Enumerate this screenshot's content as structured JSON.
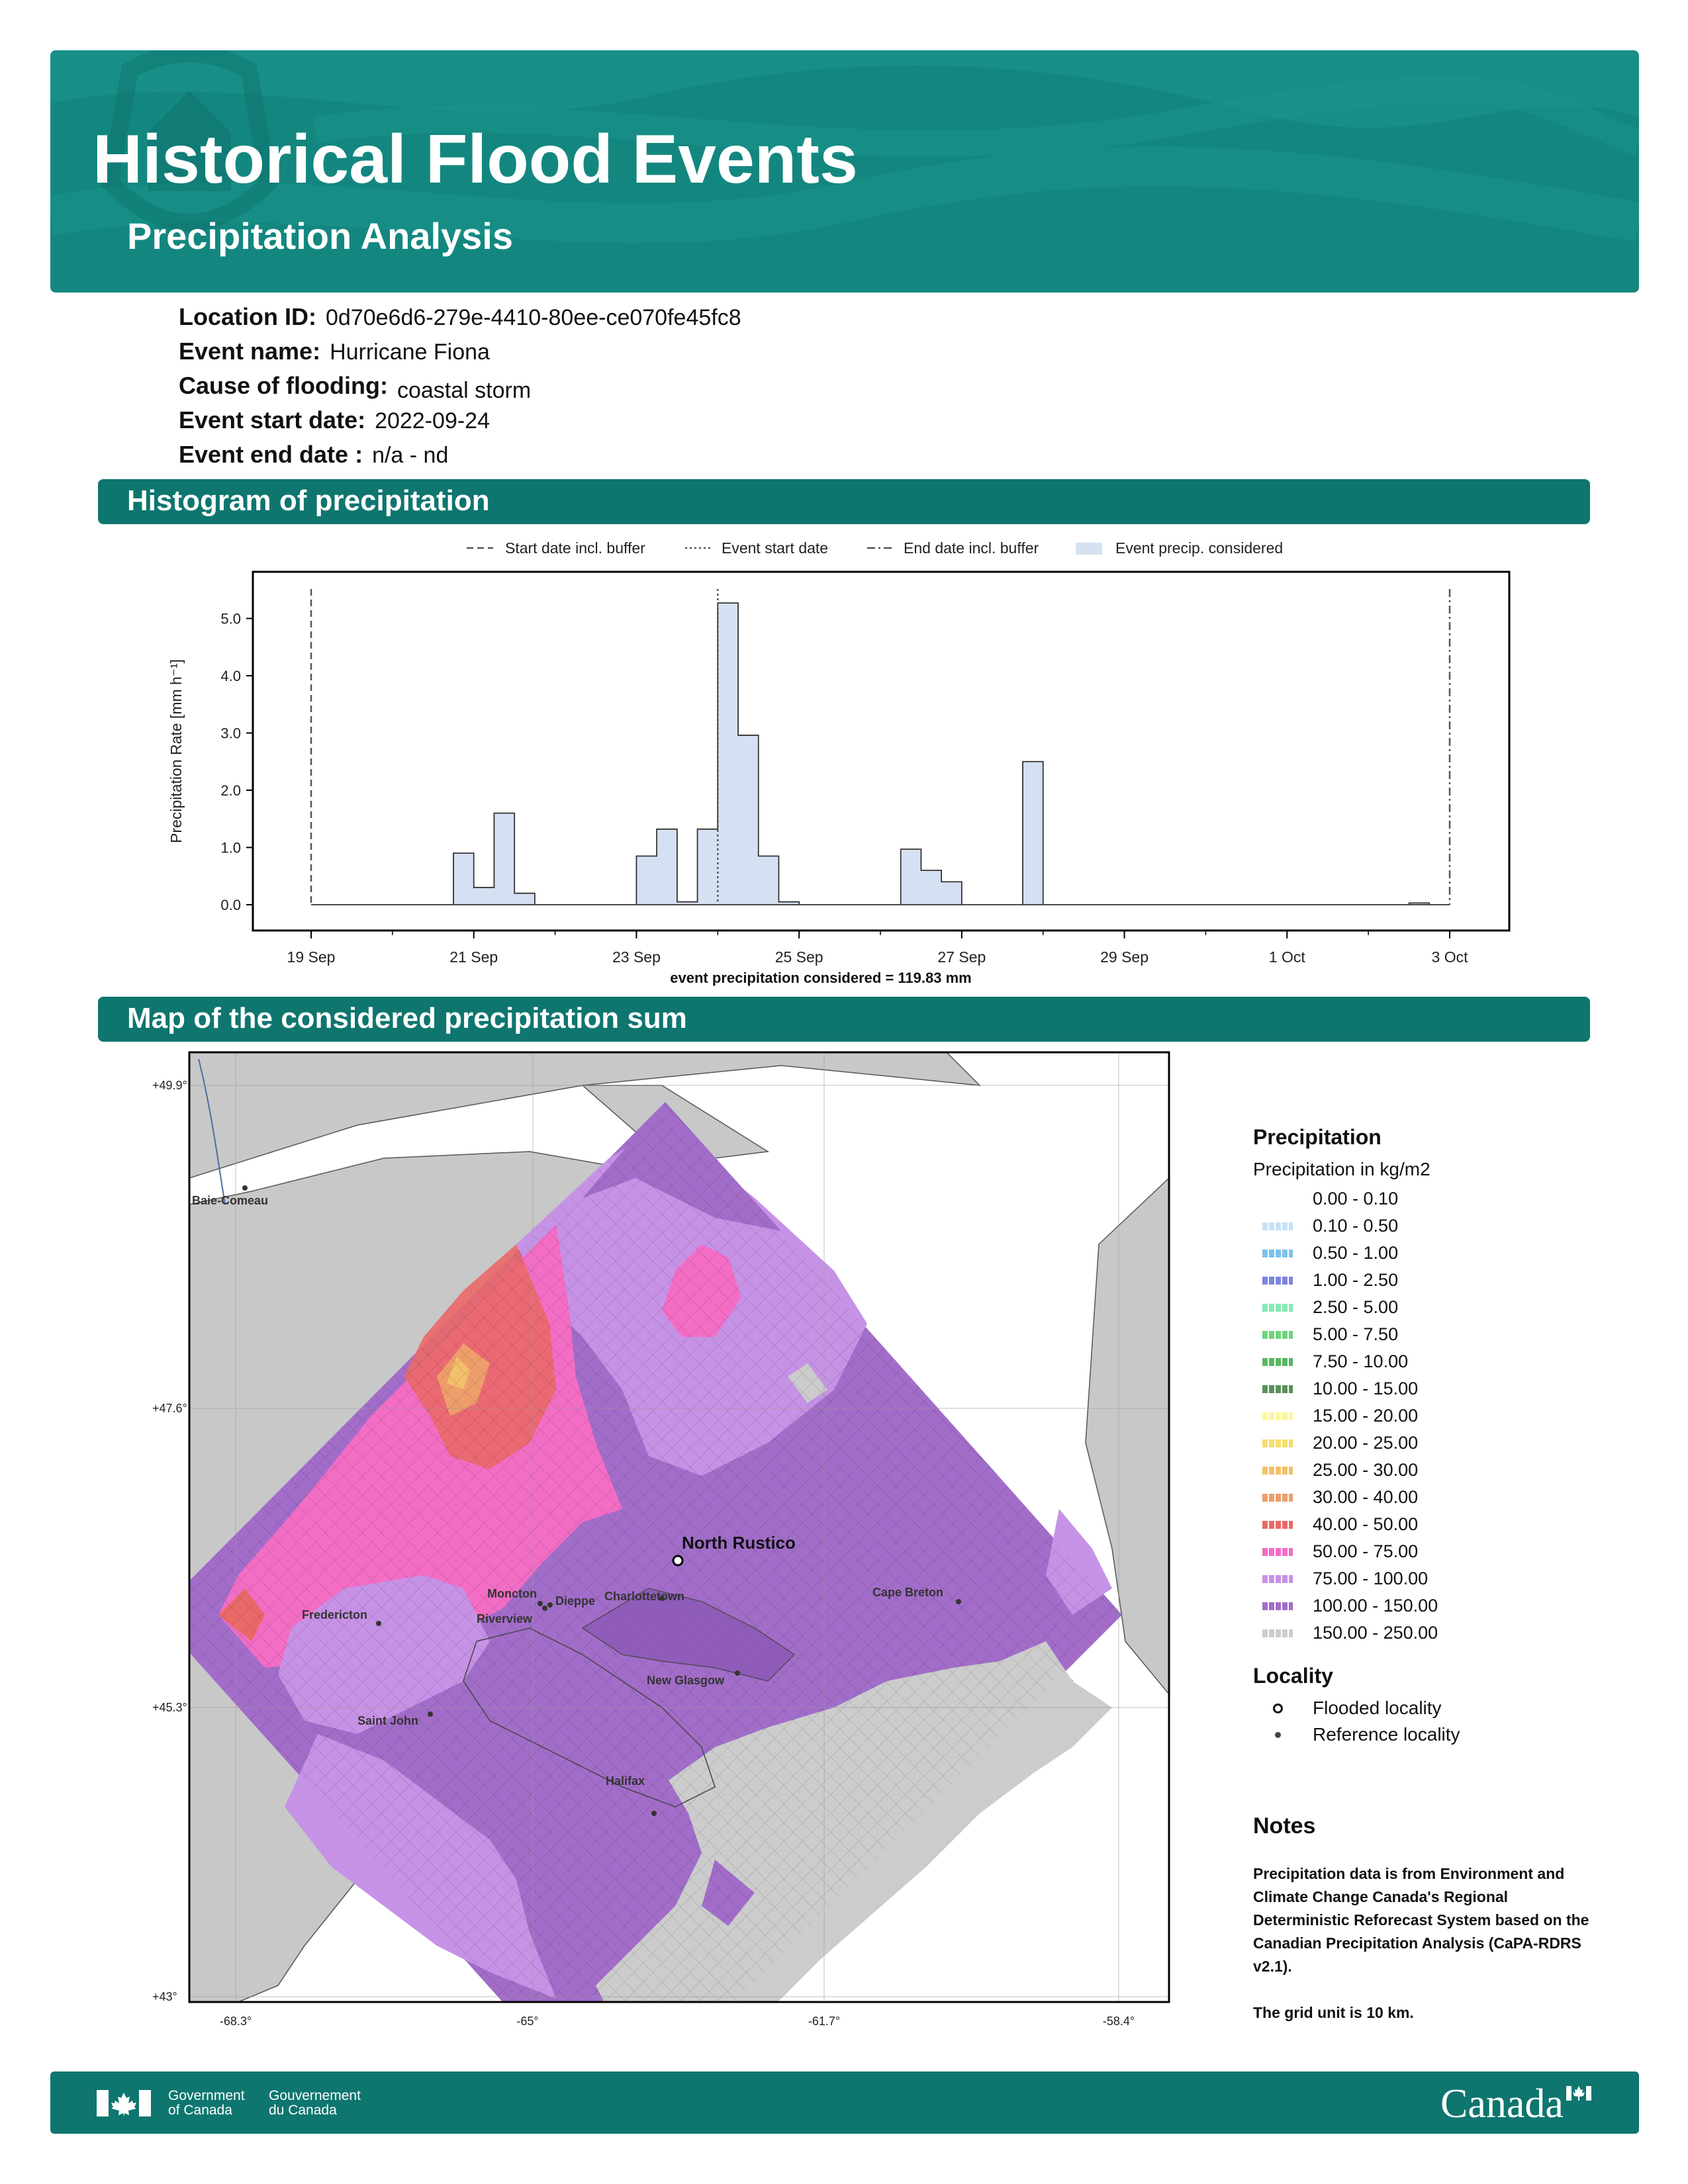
{
  "header": {
    "title": "Historical Flood Events",
    "subtitle": "Precipitation Analysis"
  },
  "event": {
    "location_id_label": "Location ID:",
    "location_id": "0d70e6d6-279e-4410-80ee-ce070fe45fc8",
    "event_name_label": "Event name:",
    "event_name": "Hurricane Fiona",
    "cause_label": "Cause of flooding:",
    "cause": "coastal storm",
    "start_label": "Event start date:",
    "start": "2022-09-24",
    "end_label": "Event end date :",
    "end": "n/a - nd"
  },
  "sections": {
    "histogram": "Histogram of precipitation",
    "map": "Map of the considered precipitation sum"
  },
  "chart_data": {
    "type": "bar",
    "ylabel": "Precipitation Rate [mm h⁻¹]",
    "xlabel": "event precipitation considered = 119.83 mm",
    "ylim": [
      -0.5,
      5.8
    ],
    "yticks": [
      "0.0",
      "1.0",
      "2.0",
      "3.0",
      "4.0",
      "5.0"
    ],
    "xticks": [
      "19 Sep",
      "21 Sep",
      "23 Sep",
      "25 Sep",
      "27 Sep",
      "29 Sep",
      "1 Oct",
      "3 Oct"
    ],
    "bin_hours": 6,
    "start_date": "2022-09-19",
    "values": [
      0,
      0,
      0,
      0,
      0,
      0,
      0,
      0.9,
      0.3,
      1.6,
      0.2,
      0,
      0,
      0,
      0,
      0,
      0.85,
      1.32,
      0.05,
      1.32,
      5.27,
      2.96,
      0.85,
      0.05,
      0,
      0,
      0,
      0,
      0,
      0.97,
      0.6,
      0.4,
      0,
      0,
      0,
      2.5,
      0,
      0,
      0,
      0,
      0,
      0,
      0,
      0,
      0,
      0,
      0,
      0,
      0,
      0,
      0,
      0,
      0,
      0,
      0.03,
      0
    ],
    "legend": [
      "Start date incl. buffer",
      "Event start date",
      "End date incl. buffer",
      "Event precip. considered"
    ],
    "start_buffer": "2022-09-19",
    "event_start": "2022-09-24",
    "end_buffer": "2022-10-03",
    "bar_color": "#d5e1f2"
  },
  "map": {
    "lat_labels": [
      "+49.9°",
      "+47.6°",
      "+45.3°",
      "+43°"
    ],
    "lon_labels": [
      "-68.3°",
      "-65°",
      "-61.7°",
      "-58.4°"
    ],
    "flooded_locality": "North Rustico",
    "reference_localities": [
      "Baie-Comeau",
      "Fredericton",
      "Moncton",
      "Dieppe",
      "Riverview",
      "Charlottetown",
      "Saint John",
      "New Glasgow",
      "Halifax",
      "Cape Breton"
    ]
  },
  "legend": {
    "title": "Precipitation",
    "subtitle": "Precipitation in kg/m2",
    "classes": [
      {
        "label": "0.00 - 0.10",
        "color": "#ffffff"
      },
      {
        "label": "0.10 - 0.50",
        "color": "#c6e2f7"
      },
      {
        "label": "0.50 - 1.00",
        "color": "#7cc3ee"
      },
      {
        "label": "1.00 - 2.50",
        "color": "#7d85e0"
      },
      {
        "label": "2.50 - 5.00",
        "color": "#86eab3"
      },
      {
        "label": "5.00 - 7.50",
        "color": "#6fd57a"
      },
      {
        "label": "7.50 - 10.00",
        "color": "#58b860"
      },
      {
        "label": "10.00 - 15.00",
        "color": "#5a915a"
      },
      {
        "label": "15.00 - 20.00",
        "color": "#fdf7a0"
      },
      {
        "label": "20.00 - 25.00",
        "color": "#f6dd6f"
      },
      {
        "label": "25.00 - 30.00",
        "color": "#f2c06a"
      },
      {
        "label": "30.00 - 40.00",
        "color": "#ee9e6a"
      },
      {
        "label": "40.00 - 50.00",
        "color": "#ea6868"
      },
      {
        "label": "50.00 - 75.00",
        "color": "#f36dc5"
      },
      {
        "label": "75.00 - 100.00",
        "color": "#c692e6"
      },
      {
        "label": "100.00 - 150.00",
        "color": "#a26dc9"
      },
      {
        "label": "150.00 - 250.00",
        "color": "#cccccc"
      }
    ],
    "locality_title": "Locality",
    "flooded_label": "Flooded locality",
    "reference_label": "Reference locality"
  },
  "notes": {
    "title": "Notes",
    "text1": "Precipitation data is from Environment and Climate Change Canada's Regional Deterministic Reforecast System based on the Canadian Precipitation Analysis (CaPA-RDRS v2.1).",
    "text2": "The grid unit is 10 km."
  },
  "footer": {
    "gov_en_1": "Government",
    "gov_en_2": "of Canada",
    "gov_fr_1": "Gouvernement",
    "gov_fr_2": "du Canada",
    "wordmark": "Canada"
  }
}
